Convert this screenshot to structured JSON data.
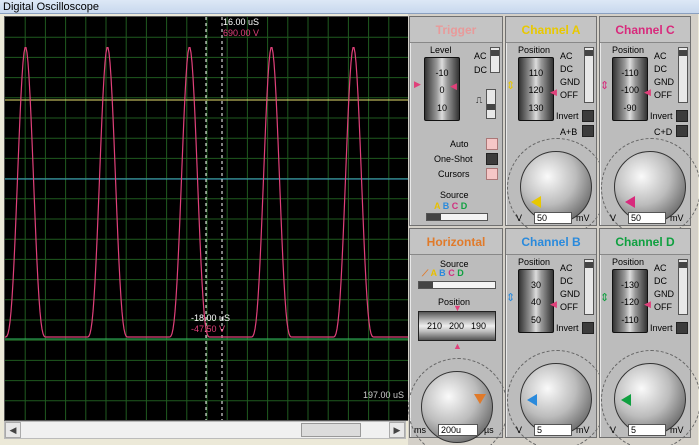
{
  "window": {
    "title": "Digital Oscilloscope"
  },
  "scope": {
    "cursor1_time": "16.00 uS",
    "cursor1_voltage": "690.00 V",
    "cursor2_time": "-18.00 uS",
    "cursor2_voltage": "-47.50 V",
    "end_time": "197.00 uS",
    "colors": {
      "grid": "#1f5a1f",
      "trace": "#e0407a",
      "cursor": "#ffffff",
      "level_a": "#e8e070",
      "level_b": "#40a8d0",
      "level_d": "#30c060"
    }
  },
  "trigger": {
    "title": "Trigger",
    "level_label": "Level",
    "ticks": [
      "-10",
      "0",
      "10"
    ],
    "coupling": [
      "AC",
      "DC"
    ],
    "modes": [
      "Auto",
      "One-Shot",
      "Cursors"
    ],
    "source_label": "Source",
    "sources": [
      "A",
      "B",
      "C",
      "D"
    ]
  },
  "horizontal": {
    "title": "Horizontal",
    "source_label": "Source",
    "sources": [
      "A",
      "B",
      "C",
      "D"
    ],
    "position_label": "Position",
    "ticks": [
      "210",
      "200",
      "190"
    ],
    "unit_left": "ms",
    "value": "200u",
    "unit_right": "µs"
  },
  "channel_a": {
    "title": "Channel A",
    "position_label": "Position",
    "ticks": [
      "110",
      "120",
      "130"
    ],
    "coupling": [
      "AC",
      "DC",
      "GND",
      "OFF"
    ],
    "invert_label": "Invert",
    "combine_label": "A+B",
    "unit_left": "V",
    "value": "50",
    "unit_right": "mV"
  },
  "channel_b": {
    "title": "Channel B",
    "position_label": "Position",
    "ticks": [
      "30",
      "40",
      "50"
    ],
    "coupling": [
      "AC",
      "DC",
      "GND",
      "OFF"
    ],
    "invert_label": "Invert",
    "unit_left": "V",
    "value": "5",
    "unit_right": "mV"
  },
  "channel_c": {
    "title": "Channel C",
    "position_label": "Position",
    "ticks": [
      "-110",
      "-100",
      "-90"
    ],
    "coupling": [
      "AC",
      "DC",
      "GND",
      "OFF"
    ],
    "invert_label": "Invert",
    "combine_label": "C+D",
    "unit_left": "V",
    "value": "50",
    "unit_right": "mV"
  },
  "channel_d": {
    "title": "Channel D",
    "position_label": "Position",
    "ticks": [
      "-130",
      "-120",
      "-110"
    ],
    "coupling": [
      "AC",
      "DC",
      "GND",
      "OFF"
    ],
    "invert_label": "Invert",
    "unit_left": "V",
    "value": "5",
    "unit_right": "mV"
  }
}
